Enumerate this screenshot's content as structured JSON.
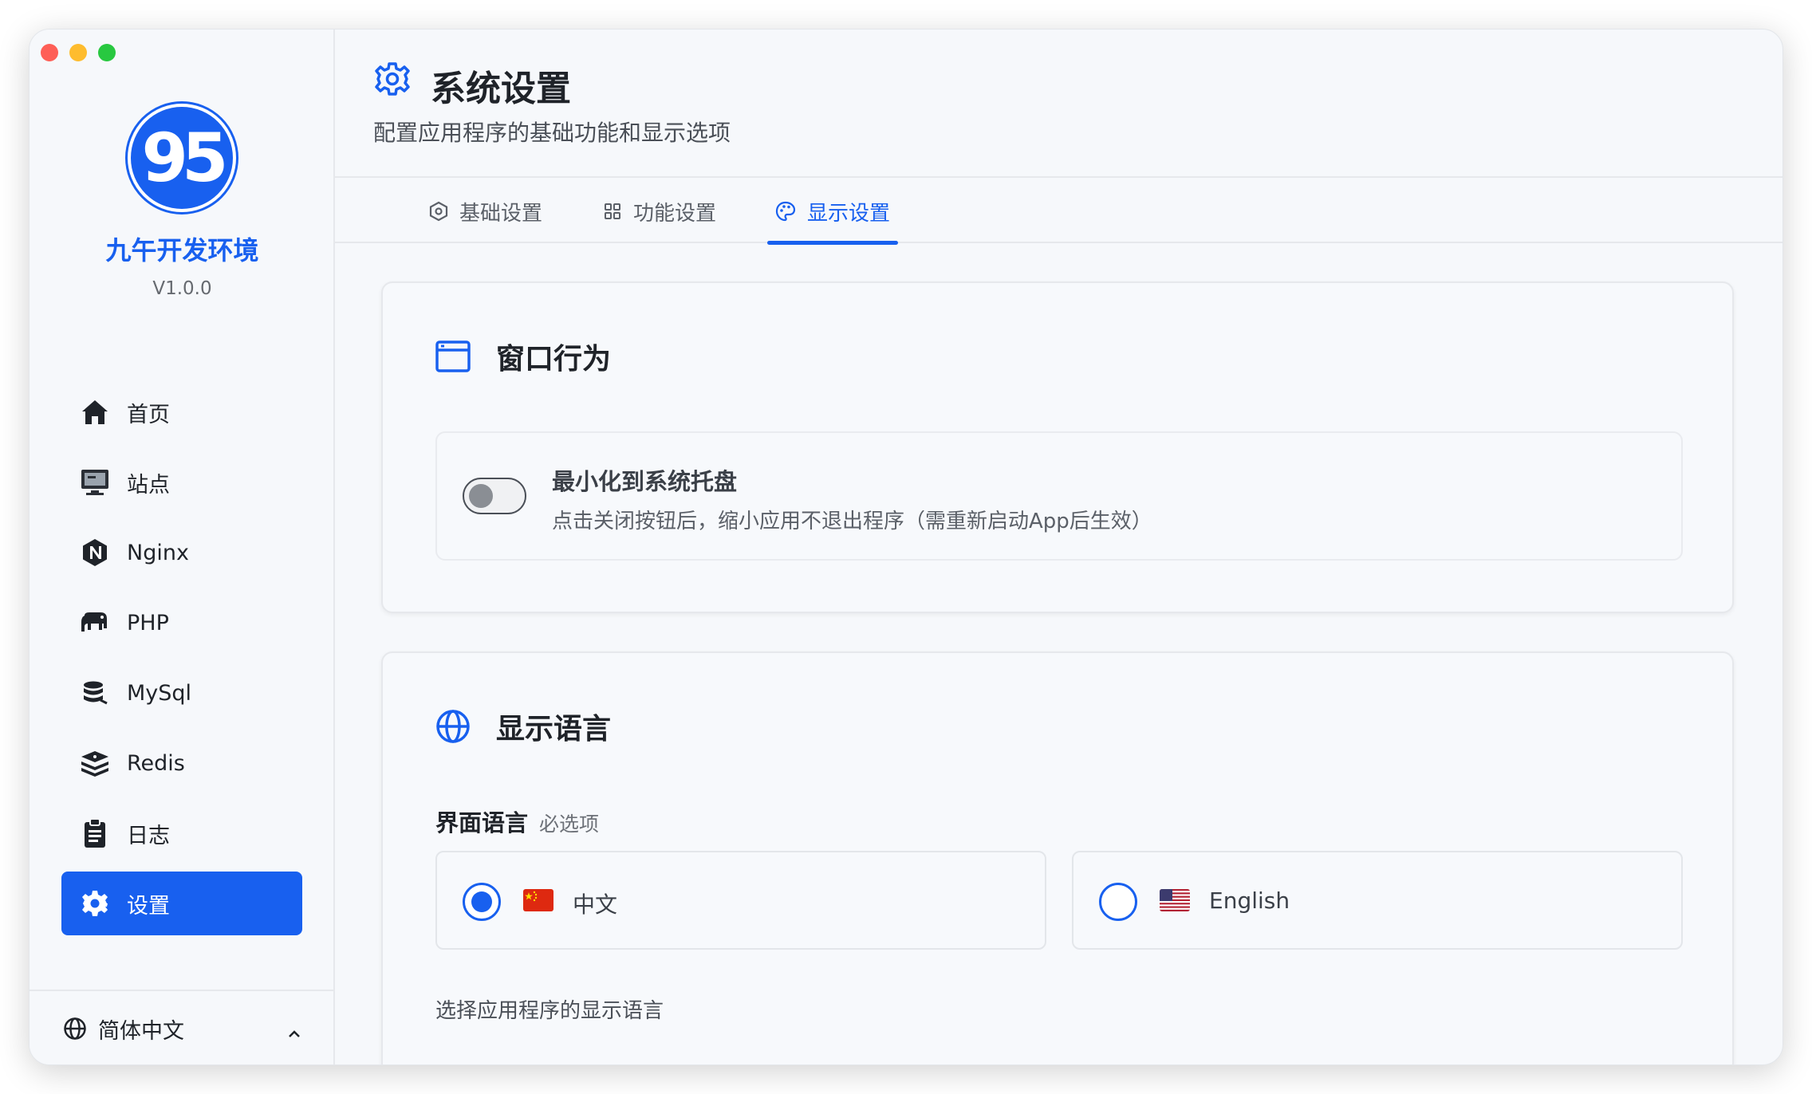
{
  "app": {
    "logo_text": "95",
    "name": "九午开发环境",
    "version": "V1.0.0"
  },
  "sidebar": {
    "items": [
      {
        "label": "首页",
        "icon": "home-icon"
      },
      {
        "label": "站点",
        "icon": "monitor-icon"
      },
      {
        "label": "Nginx",
        "icon": "nginx-icon"
      },
      {
        "label": "PHP",
        "icon": "elephant-icon"
      },
      {
        "label": "MySql",
        "icon": "database-icon"
      },
      {
        "label": "Redis",
        "icon": "layers-icon"
      },
      {
        "label": "日志",
        "icon": "clipboard-icon"
      },
      {
        "label": "设置",
        "icon": "gear-icon",
        "active": true
      }
    ],
    "language": {
      "label": "简体中文",
      "icon": "globe-icon"
    }
  },
  "header": {
    "title": "系统设置",
    "subtitle": "配置应用程序的基础功能和显示选项"
  },
  "tabs": [
    {
      "label": "基础设置",
      "icon": "hexagon-gear-icon"
    },
    {
      "label": "功能设置",
      "icon": "grid-icon"
    },
    {
      "label": "显示设置",
      "icon": "palette-icon",
      "active": true
    }
  ],
  "window_behavior": {
    "title": "窗口行为",
    "minimize_tray": {
      "title": "最小化到系统托盘",
      "description": "点击关闭按钮后，缩小应用不退出程序（需重新启动App后生效）",
      "enabled": false
    }
  },
  "display_language": {
    "title": "显示语言",
    "field_label": "界面语言",
    "field_required": "必选项",
    "options": [
      {
        "label": "中文",
        "flag": "cn-flag",
        "selected": true
      },
      {
        "label": "English",
        "flag": "us-flag",
        "selected": false
      }
    ],
    "help": "选择应用程序的显示语言"
  },
  "colors": {
    "accent": "#1860ef",
    "background": "#f6f8fb"
  }
}
